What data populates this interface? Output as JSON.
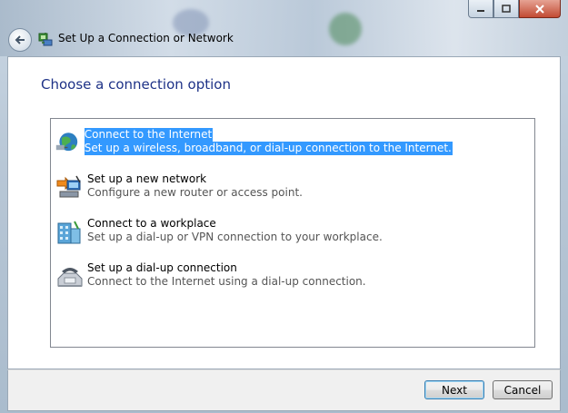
{
  "window": {
    "title": "Set Up a Connection or Network",
    "caption_buttons": {
      "minimize": "minimize-icon",
      "maximize": "maximize-icon",
      "close": "close-icon"
    }
  },
  "nav": {
    "back_icon": "back-arrow-icon"
  },
  "heading": "Choose a connection option",
  "options": [
    {
      "title": "Connect to the Internet",
      "desc": "Set up a wireless, broadband, or dial-up connection to the Internet.",
      "icon": "globe-network-icon",
      "selected": true
    },
    {
      "title": "Set up a new network",
      "desc": "Configure a new router or access point.",
      "icon": "new-network-icon",
      "selected": false
    },
    {
      "title": "Connect to a workplace",
      "desc": "Set up a dial-up or VPN connection to your workplace.",
      "icon": "workplace-icon",
      "selected": false
    },
    {
      "title": "Set up a dial-up connection",
      "desc": "Connect to the Internet using a dial-up connection.",
      "icon": "phone-modem-icon",
      "selected": false
    }
  ],
  "buttons": {
    "next": "Next",
    "cancel": "Cancel"
  },
  "colors": {
    "selection": "#3399ff",
    "heading": "#1e3287",
    "window_glass": "#b8c7d6",
    "close_button": "#c24b33"
  }
}
